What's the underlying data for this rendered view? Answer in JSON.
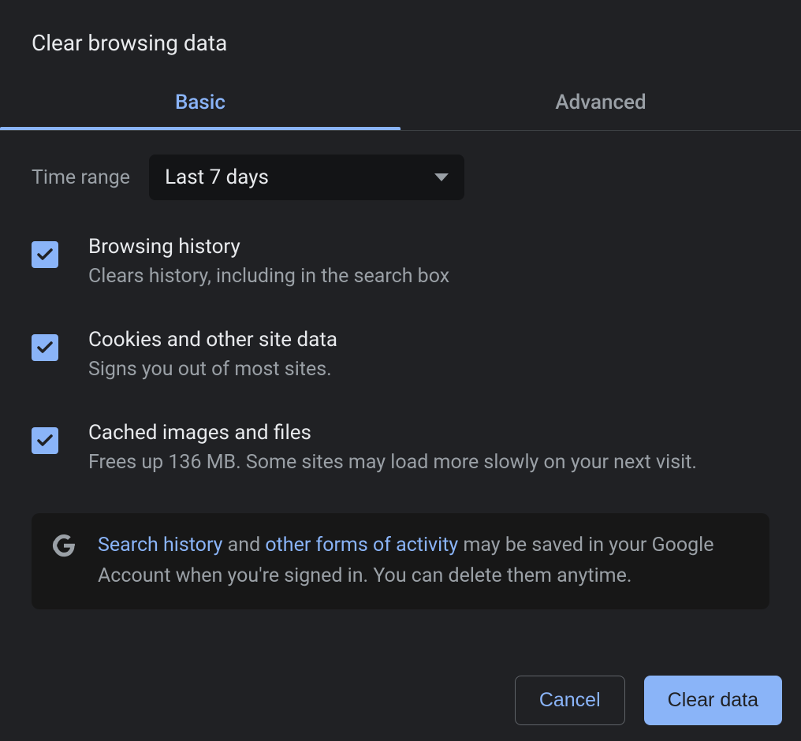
{
  "dialog": {
    "title": "Clear browsing data"
  },
  "tabs": {
    "basic": "Basic",
    "advanced": "Advanced"
  },
  "time_range": {
    "label": "Time range",
    "value": "Last 7 days"
  },
  "options": {
    "browsing_history": {
      "title": "Browsing history",
      "desc": "Clears history, including in the search box"
    },
    "cookies": {
      "title": "Cookies and other site data",
      "desc": "Signs you out of most sites."
    },
    "cache": {
      "title": "Cached images and files",
      "desc": "Frees up 136 MB. Some sites may load more slowly on your next visit."
    }
  },
  "info": {
    "link1": "Search history",
    "text1": " and ",
    "link2": "other forms of activity",
    "text2": " may be saved in your Google Account when you're signed in. You can delete them anytime."
  },
  "buttons": {
    "cancel": "Cancel",
    "clear": "Clear data"
  }
}
